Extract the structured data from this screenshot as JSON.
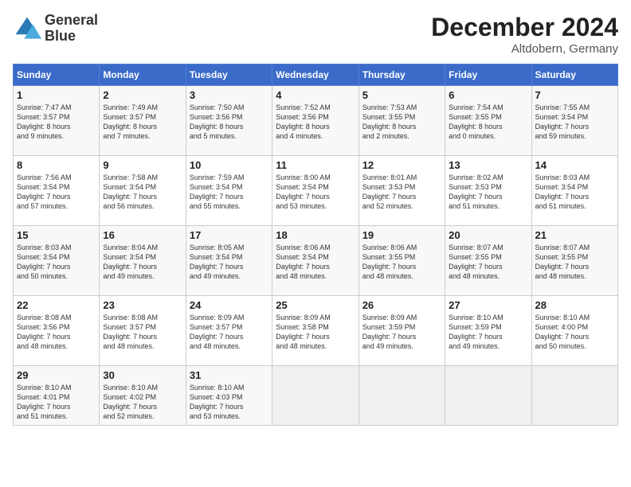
{
  "header": {
    "logo_line1": "General",
    "logo_line2": "Blue",
    "month": "December 2024",
    "location": "Altdobern, Germany"
  },
  "weekdays": [
    "Sunday",
    "Monday",
    "Tuesday",
    "Wednesday",
    "Thursday",
    "Friday",
    "Saturday"
  ],
  "weeks": [
    [
      {
        "day": "1",
        "info": "Sunrise: 7:47 AM\nSunset: 3:57 PM\nDaylight: 8 hours\nand 9 minutes."
      },
      {
        "day": "2",
        "info": "Sunrise: 7:49 AM\nSunset: 3:57 PM\nDaylight: 8 hours\nand 7 minutes."
      },
      {
        "day": "3",
        "info": "Sunrise: 7:50 AM\nSunset: 3:56 PM\nDaylight: 8 hours\nand 5 minutes."
      },
      {
        "day": "4",
        "info": "Sunrise: 7:52 AM\nSunset: 3:56 PM\nDaylight: 8 hours\nand 4 minutes."
      },
      {
        "day": "5",
        "info": "Sunrise: 7:53 AM\nSunset: 3:55 PM\nDaylight: 8 hours\nand 2 minutes."
      },
      {
        "day": "6",
        "info": "Sunrise: 7:54 AM\nSunset: 3:55 PM\nDaylight: 8 hours\nand 0 minutes."
      },
      {
        "day": "7",
        "info": "Sunrise: 7:55 AM\nSunset: 3:54 PM\nDaylight: 7 hours\nand 59 minutes."
      }
    ],
    [
      {
        "day": "8",
        "info": "Sunrise: 7:56 AM\nSunset: 3:54 PM\nDaylight: 7 hours\nand 57 minutes."
      },
      {
        "day": "9",
        "info": "Sunrise: 7:58 AM\nSunset: 3:54 PM\nDaylight: 7 hours\nand 56 minutes."
      },
      {
        "day": "10",
        "info": "Sunrise: 7:59 AM\nSunset: 3:54 PM\nDaylight: 7 hours\nand 55 minutes."
      },
      {
        "day": "11",
        "info": "Sunrise: 8:00 AM\nSunset: 3:54 PM\nDaylight: 7 hours\nand 53 minutes."
      },
      {
        "day": "12",
        "info": "Sunrise: 8:01 AM\nSunset: 3:53 PM\nDaylight: 7 hours\nand 52 minutes."
      },
      {
        "day": "13",
        "info": "Sunrise: 8:02 AM\nSunset: 3:53 PM\nDaylight: 7 hours\nand 51 minutes."
      },
      {
        "day": "14",
        "info": "Sunrise: 8:03 AM\nSunset: 3:54 PM\nDaylight: 7 hours\nand 51 minutes."
      }
    ],
    [
      {
        "day": "15",
        "info": "Sunrise: 8:03 AM\nSunset: 3:54 PM\nDaylight: 7 hours\nand 50 minutes."
      },
      {
        "day": "16",
        "info": "Sunrise: 8:04 AM\nSunset: 3:54 PM\nDaylight: 7 hours\nand 49 minutes."
      },
      {
        "day": "17",
        "info": "Sunrise: 8:05 AM\nSunset: 3:54 PM\nDaylight: 7 hours\nand 49 minutes."
      },
      {
        "day": "18",
        "info": "Sunrise: 8:06 AM\nSunset: 3:54 PM\nDaylight: 7 hours\nand 48 minutes."
      },
      {
        "day": "19",
        "info": "Sunrise: 8:06 AM\nSunset: 3:55 PM\nDaylight: 7 hours\nand 48 minutes."
      },
      {
        "day": "20",
        "info": "Sunrise: 8:07 AM\nSunset: 3:55 PM\nDaylight: 7 hours\nand 48 minutes."
      },
      {
        "day": "21",
        "info": "Sunrise: 8:07 AM\nSunset: 3:55 PM\nDaylight: 7 hours\nand 48 minutes."
      }
    ],
    [
      {
        "day": "22",
        "info": "Sunrise: 8:08 AM\nSunset: 3:56 PM\nDaylight: 7 hours\nand 48 minutes."
      },
      {
        "day": "23",
        "info": "Sunrise: 8:08 AM\nSunset: 3:57 PM\nDaylight: 7 hours\nand 48 minutes."
      },
      {
        "day": "24",
        "info": "Sunrise: 8:09 AM\nSunset: 3:57 PM\nDaylight: 7 hours\nand 48 minutes."
      },
      {
        "day": "25",
        "info": "Sunrise: 8:09 AM\nSunset: 3:58 PM\nDaylight: 7 hours\nand 48 minutes."
      },
      {
        "day": "26",
        "info": "Sunrise: 8:09 AM\nSunset: 3:59 PM\nDaylight: 7 hours\nand 49 minutes."
      },
      {
        "day": "27",
        "info": "Sunrise: 8:10 AM\nSunset: 3:59 PM\nDaylight: 7 hours\nand 49 minutes."
      },
      {
        "day": "28",
        "info": "Sunrise: 8:10 AM\nSunset: 4:00 PM\nDaylight: 7 hours\nand 50 minutes."
      }
    ],
    [
      {
        "day": "29",
        "info": "Sunrise: 8:10 AM\nSunset: 4:01 PM\nDaylight: 7 hours\nand 51 minutes."
      },
      {
        "day": "30",
        "info": "Sunrise: 8:10 AM\nSunset: 4:02 PM\nDaylight: 7 hours\nand 52 minutes."
      },
      {
        "day": "31",
        "info": "Sunrise: 8:10 AM\nSunset: 4:03 PM\nDaylight: 7 hours\nand 53 minutes."
      },
      {
        "day": "",
        "info": ""
      },
      {
        "day": "",
        "info": ""
      },
      {
        "day": "",
        "info": ""
      },
      {
        "day": "",
        "info": ""
      }
    ]
  ]
}
